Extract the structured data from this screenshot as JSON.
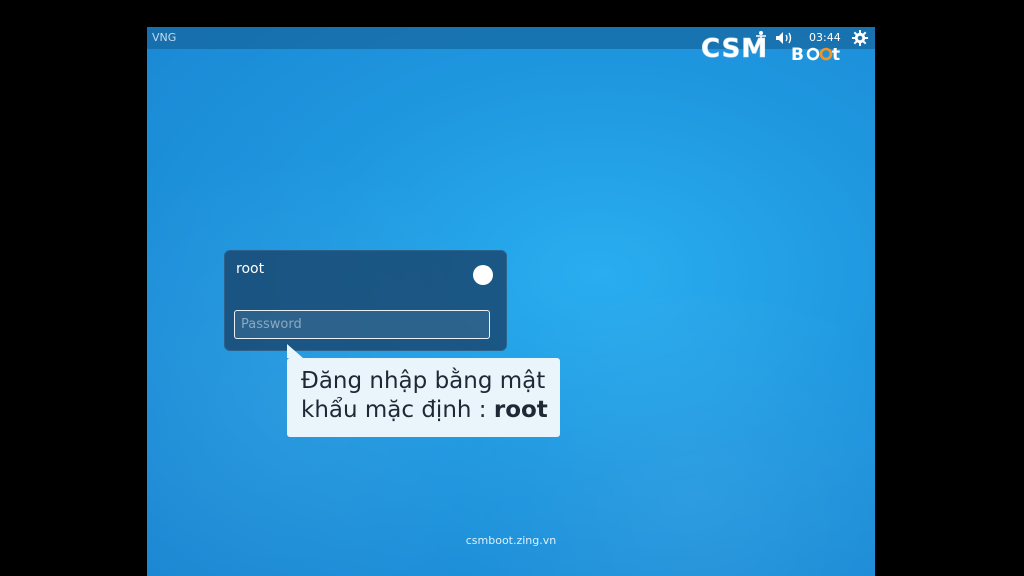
{
  "topbar": {
    "title": "VNG",
    "clock": "03:44",
    "icons": [
      "accessibility-icon",
      "volume-icon",
      "gear-icon"
    ]
  },
  "logo": {
    "text": "CSMBoot"
  },
  "login": {
    "user_name": "root",
    "password_placeholder": "Password",
    "password_value": ""
  },
  "callout": {
    "line1": "Đăng nhập bằng mật",
    "line2_prefix": "khẩu mặc định : ",
    "line2_bold": "root"
  },
  "footer": {
    "url": "csmboot.zing.vn"
  },
  "colors": {
    "background": "#1f98e0",
    "card": "#19466e",
    "callout_bg": "#eaf4fb",
    "logo_orange": "#f7941d"
  }
}
